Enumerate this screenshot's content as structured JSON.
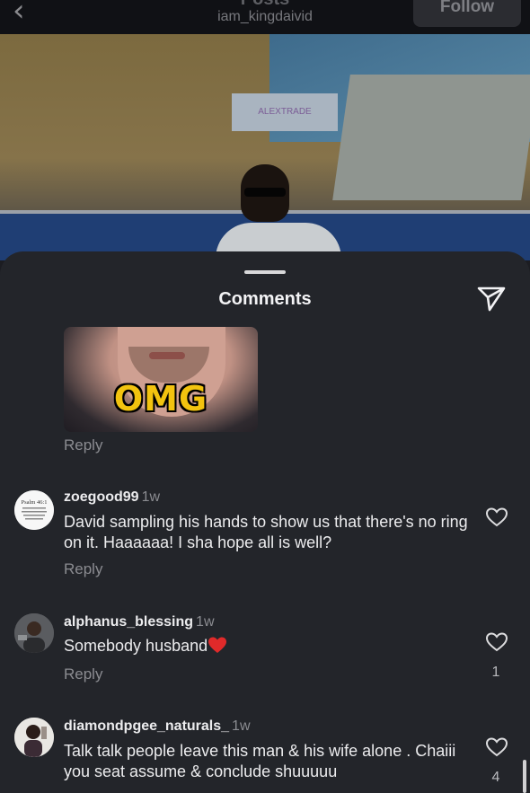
{
  "header": {
    "title": "Posts",
    "username": "iam_kingdaivid",
    "follow_label": "Follow"
  },
  "video": {
    "sign_text": "ALEXTRADE"
  },
  "sheet": {
    "title": "Comments"
  },
  "gif_comment": {
    "gif_text": "OMG",
    "reply_label": "Reply"
  },
  "comments": [
    {
      "username": "zoegood99",
      "time": "1w",
      "text": "David sampling his hands to show us that there's no ring on it. Haaaaaa! I sha hope all is well?",
      "reply_label": "Reply",
      "likes": "",
      "avatar_text": "Psalm 46:1"
    },
    {
      "username": "alphanus_blessing",
      "time": "1w",
      "text": "Somebody husband",
      "reply_label": "Reply",
      "likes": "1"
    },
    {
      "username": "diamondpgee_naturals_",
      "time": "1w",
      "text": "Talk talk people leave this man & his wife alone . Chaiii you seat assume & conclude shuuuuu",
      "likes": "4"
    }
  ],
  "colors": {
    "sheet_bg": "#23252a",
    "heart_emoji": "#e02a2a",
    "gif_text": "#f2c30f"
  }
}
